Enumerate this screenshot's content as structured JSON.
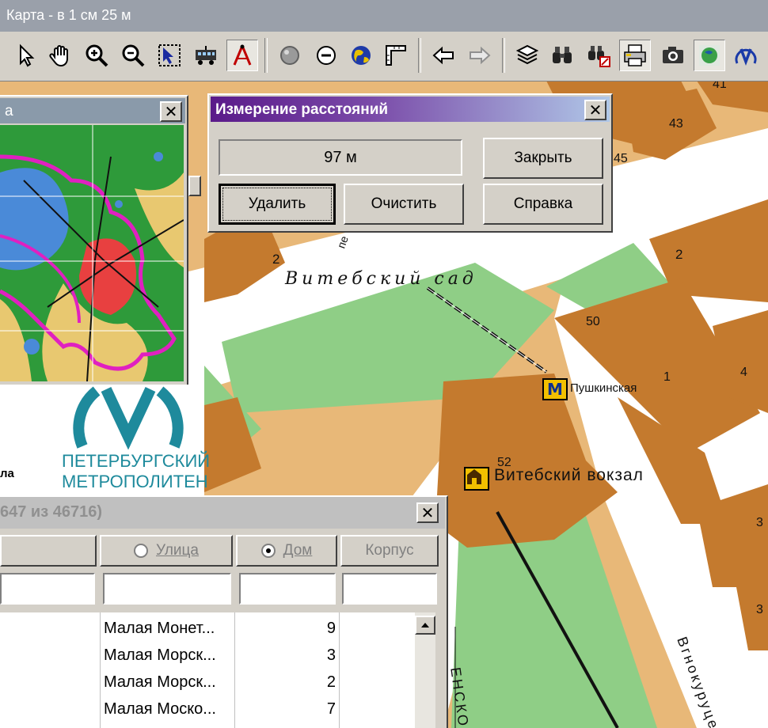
{
  "window": {
    "title": "Карта - в 1 см 25 м"
  },
  "toolbar": {
    "buttons": [
      {
        "name": "pointer-icon"
      },
      {
        "name": "hand-icon"
      },
      {
        "name": "zoom-in-icon"
      },
      {
        "name": "zoom-out-icon"
      },
      {
        "name": "zoom-rect-icon"
      },
      {
        "name": "train-icon"
      },
      {
        "name": "compass-measure-icon"
      },
      {
        "name": "gray-circle-icon"
      },
      {
        "name": "minus-circle-icon"
      },
      {
        "name": "globe-icon"
      },
      {
        "name": "ruler-icon"
      },
      {
        "name": "back-arrow-icon"
      },
      {
        "name": "forward-arrow-icon"
      },
      {
        "name": "layers-icon"
      },
      {
        "name": "binoculars-icon"
      },
      {
        "name": "binoculars-search-icon"
      },
      {
        "name": "print-preview-icon"
      },
      {
        "name": "camera-icon"
      },
      {
        "name": "map-globe-icon"
      },
      {
        "name": "metro-logo-icon"
      }
    ],
    "metro_letter": "M"
  },
  "overview": {
    "title_fragment": "а",
    "close": "✕"
  },
  "logo": {
    "line1": "ПЕТЕРБУРГСКИЙ",
    "line2": "МЕТРОПОЛИТЕН",
    "left_fragment": "ла"
  },
  "measure_dialog": {
    "title": "Измерение расстояний",
    "distance": "97 м",
    "close_label": "Закрыть",
    "delete_label": "Удалить",
    "clear_label": "Очистить",
    "help_label": "Справка",
    "close_x": "✕"
  },
  "search_panel": {
    "title": "647 из 46716)",
    "close_x": "✕",
    "columns": {
      "street": "Улица",
      "house": "Дом",
      "building": "Корпус"
    },
    "selected_column": "house",
    "rows": [
      {
        "street": "Малая Монет...",
        "house": "9"
      },
      {
        "street": "Малая Морск...",
        "house": "3"
      },
      {
        "street": "Малая Морск...",
        "house": "2"
      },
      {
        "street": "Малая Моско...",
        "house": "7"
      }
    ]
  },
  "map": {
    "labels": {
      "garden": "Витебский сад",
      "metro_station": "Пушкинская",
      "station": "Витебский вокзал",
      "street_upper": "пе",
      "street_right": "Вгнокуруце",
      "street_bottom": "ЕНСКО"
    },
    "house_numbers": [
      "41",
      "43",
      "45",
      "2",
      "2",
      "50",
      "1",
      "4",
      "52",
      "3",
      "3"
    ]
  },
  "colors": {
    "building": "#c47a2e",
    "block": "#e8b878",
    "park": "#8fce86",
    "street": "#ffffff",
    "dialog_title_start": "#5a1a8a",
    "dialog_title_end": "#b0c8e8",
    "metro_blue": "#0d2f8f",
    "logo_teal": "#1e8a9c"
  }
}
